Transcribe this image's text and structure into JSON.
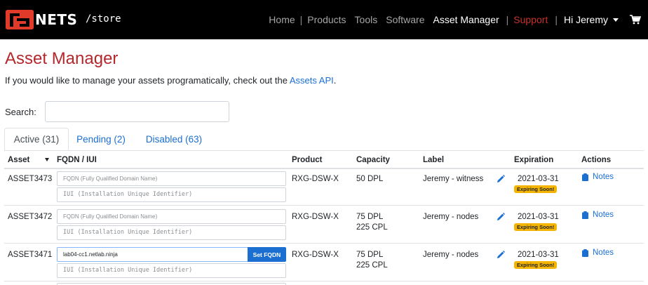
{
  "brand": {
    "name": "NETS",
    "path": "/store"
  },
  "nav": {
    "home": "Home",
    "products": "Products",
    "tools": "Tools",
    "software": "Software",
    "asset_manager": "Asset Manager",
    "support": "Support",
    "user": "Hi Jeremy",
    "sep": "|"
  },
  "page": {
    "title": "Asset Manager",
    "intro_text": "If you would like to manage your assets programatically, check out the ",
    "intro_link": "Assets API",
    "intro_end": "."
  },
  "search": {
    "label": "Search:",
    "value": ""
  },
  "tabs": [
    {
      "label": "Active (31)"
    },
    {
      "label": "Pending (2)"
    },
    {
      "label": "Disabled (63)"
    }
  ],
  "table": {
    "headers": {
      "asset": "Asset",
      "fqdn": "FQDN / IUI",
      "product": "Product",
      "capacity": "Capacity",
      "label": "Label",
      "expiration": "Expiration",
      "actions": "Actions"
    },
    "fqdn_placeholder": "FQDN (Fully Qualified Domain Name)",
    "iui_placeholder": "IUI (Installation Unique Identifier)",
    "set_fqdn_label": "Set FQDN",
    "rows": [
      {
        "asset": "ASSET3473",
        "fqdn": "",
        "product": "RXG-DSW-X",
        "capacity_1": "50 DPL",
        "capacity_2": "",
        "label": "Jeremy - witness",
        "expiration": "2021-03-31",
        "badge": "Expiring Soon!",
        "notes": "Notes"
      },
      {
        "asset": "ASSET3472",
        "fqdn": "",
        "product": "RXG-DSW-X",
        "capacity_1": "75 DPL",
        "capacity_2": "225 CPL",
        "label": "Jeremy - nodes",
        "expiration": "2021-03-31",
        "badge": "Expiring Soon!",
        "notes": "Notes"
      },
      {
        "asset": "ASSET3471",
        "fqdn": "lab04-cc1.netlab.ninja",
        "product": "RXG-DSW-X",
        "capacity_1": "75 DPL",
        "capacity_2": "225 CPL",
        "label": "Jeremy - nodes",
        "expiration": "2021-03-31",
        "badge": "Expiring Soon!",
        "notes": "Notes"
      }
    ]
  },
  "colors": {
    "brand_red": "#e23a2a",
    "title_red": "#b3282d",
    "link_blue": "#1a6fd1",
    "badge_yellow": "#f4b400"
  }
}
